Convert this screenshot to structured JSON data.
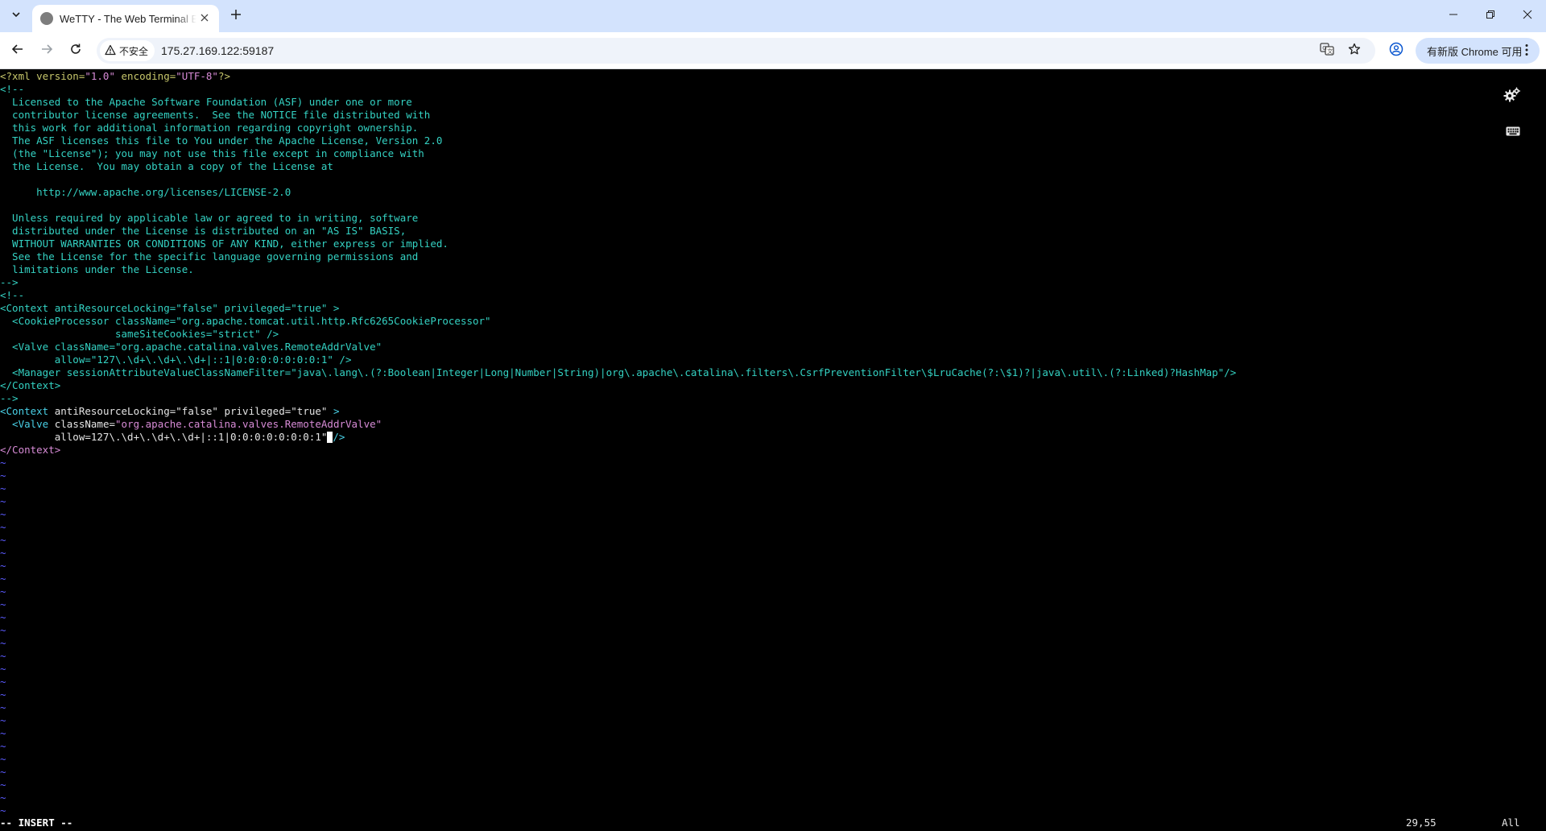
{
  "browser": {
    "tab": {
      "title": "WeTTY - The Web Terminal Emulator"
    },
    "address": {
      "security_label": "不安全",
      "url": "175.27.169.122:59187"
    },
    "update_chip": {
      "label": "有新版 Chrome 可用"
    },
    "icons": {
      "tab_search": "chevron-down-icon",
      "favicon": "globe-icon",
      "close": "close-icon",
      "new_tab": "plus-icon",
      "back": "arrow-left-icon",
      "forward": "arrow-right-icon",
      "reload": "reload-icon",
      "warning": "warning-triangle-icon",
      "translate": "translate-icon",
      "bookmark": "star-icon",
      "profile": "profile-icon",
      "menu": "kebab-menu-icon"
    }
  },
  "terminal": {
    "colors": {
      "license_comment": "#34d2c3",
      "tag": "#49d0e6",
      "attribute": "#e5e5e5",
      "value": "#d78bd6",
      "tilde": "#5b5bff"
    },
    "lines": [
      {
        "segments": [
          {
            "t": "<?xml version=",
            "c": "pi"
          },
          {
            "t": "\"1.0\"",
            "c": "val"
          },
          {
            "t": " encoding=",
            "c": "pi"
          },
          {
            "t": "\"UTF-8\"",
            "c": "val"
          },
          {
            "t": "?>",
            "c": "pi"
          }
        ]
      },
      {
        "segments": [
          {
            "t": "<!--",
            "c": "lic"
          }
        ]
      },
      {
        "segments": [
          {
            "t": "  Licensed to the Apache Software Foundation (ASF) under one or more",
            "c": "lic"
          }
        ]
      },
      {
        "segments": [
          {
            "t": "  contributor license agreements.  See the NOTICE file distributed with",
            "c": "lic"
          }
        ]
      },
      {
        "segments": [
          {
            "t": "  this work for additional information regarding copyright ownership.",
            "c": "lic"
          }
        ]
      },
      {
        "segments": [
          {
            "t": "  The ASF licenses this file to You under the Apache License, Version 2.0",
            "c": "lic"
          }
        ]
      },
      {
        "segments": [
          {
            "t": "  (the \"License\"); you may not use this file except in compliance with",
            "c": "lic"
          }
        ]
      },
      {
        "segments": [
          {
            "t": "  the License.  You may obtain a copy of the License at",
            "c": "lic"
          }
        ]
      },
      {
        "segments": [
          {
            "t": "",
            "c": "lic"
          }
        ]
      },
      {
        "segments": [
          {
            "t": "      http://www.apache.org/licenses/LICENSE-2.0",
            "c": "lic"
          }
        ]
      },
      {
        "segments": [
          {
            "t": "",
            "c": "lic"
          }
        ]
      },
      {
        "segments": [
          {
            "t": "  Unless required by applicable law or agreed to in writing, software",
            "c": "lic"
          }
        ]
      },
      {
        "segments": [
          {
            "t": "  distributed under the License is distributed on an \"AS IS\" BASIS,",
            "c": "lic"
          }
        ]
      },
      {
        "segments": [
          {
            "t": "  WITHOUT WARRANTIES OR CONDITIONS OF ANY KIND, either express or implied.",
            "c": "lic"
          }
        ]
      },
      {
        "segments": [
          {
            "t": "  See the License for the specific language governing permissions and",
            "c": "lic"
          }
        ]
      },
      {
        "segments": [
          {
            "t": "  limitations under the License.",
            "c": "lic"
          }
        ]
      },
      {
        "segments": [
          {
            "t": "-->",
            "c": "lic"
          }
        ]
      },
      {
        "segments": [
          {
            "t": "<!--",
            "c": "lic"
          }
        ]
      },
      {
        "segments": [
          {
            "t": "<Context antiResourceLocking=\"false\" privileged=\"true\" >",
            "c": "lic"
          }
        ]
      },
      {
        "segments": [
          {
            "t": "  <CookieProcessor className=\"org.apache.tomcat.util.http.Rfc6265CookieProcessor\"",
            "c": "lic"
          }
        ]
      },
      {
        "segments": [
          {
            "t": "                   sameSiteCookies=\"strict\" />",
            "c": "lic"
          }
        ]
      },
      {
        "segments": [
          {
            "t": "  <Valve className=\"org.apache.catalina.valves.RemoteAddrValve\"",
            "c": "lic"
          }
        ]
      },
      {
        "segments": [
          {
            "t": "         allow=\"127\\.\\d+\\.\\d+\\.\\d+|::1|0:0:0:0:0:0:0:1\" />",
            "c": "lic"
          }
        ]
      },
      {
        "segments": [
          {
            "t": "  <Manager sessionAttributeValueClassNameFilter=\"java\\.lang\\.(?:Boolean|Integer|Long|Number|String)|org\\.apache\\.catalina\\.filters\\.CsrfPreventionFilter\\$LruCache(?:\\$1)?|java\\.util\\.(?:Linked)?HashMap\"/>",
            "c": "lic"
          }
        ]
      },
      {
        "segments": [
          {
            "t": "</Context>",
            "c": "lic"
          }
        ]
      },
      {
        "segments": [
          {
            "t": "-->",
            "c": "lic"
          }
        ]
      },
      {
        "segments": [
          {
            "t": "<Context",
            "c": "tag"
          },
          {
            "t": " antiResourceLocking=",
            "c": "attr"
          },
          {
            "t": "\"false\"",
            "c": "valw"
          },
          {
            "t": " privileged=",
            "c": "attr"
          },
          {
            "t": "\"true\"",
            "c": "valw"
          },
          {
            "t": " >",
            "c": "tag"
          }
        ]
      },
      {
        "segments": [
          {
            "t": "  <Valve",
            "c": "tag"
          },
          {
            "t": " className=",
            "c": "attr"
          },
          {
            "t": "\"org.apache.catalina.valves.RemoteAddrValve\"",
            "c": "val"
          }
        ]
      },
      {
        "segments": [
          {
            "t": "         allow=127\\.\\d+\\.\\d+\\.\\d+|::1|0:0:0:0:0:0:0:1\"",
            "c": "valw"
          },
          {
            "t": "",
            "c": "cursor"
          },
          {
            "t": "/>",
            "c": "tag"
          }
        ]
      },
      {
        "segments": [
          {
            "t": "</Context>",
            "c": "val"
          }
        ]
      },
      {
        "segments": [
          {
            "t": "~",
            "c": "tilde"
          }
        ]
      },
      {
        "segments": [
          {
            "t": "~",
            "c": "tilde"
          }
        ]
      },
      {
        "segments": [
          {
            "t": "~",
            "c": "tilde"
          }
        ]
      },
      {
        "segments": [
          {
            "t": "~",
            "c": "tilde"
          }
        ]
      },
      {
        "segments": [
          {
            "t": "~",
            "c": "tilde"
          }
        ]
      },
      {
        "segments": [
          {
            "t": "~",
            "c": "tilde"
          }
        ]
      },
      {
        "segments": [
          {
            "t": "~",
            "c": "tilde"
          }
        ]
      },
      {
        "segments": [
          {
            "t": "~",
            "c": "tilde"
          }
        ]
      },
      {
        "segments": [
          {
            "t": "~",
            "c": "tilde"
          }
        ]
      },
      {
        "segments": [
          {
            "t": "~",
            "c": "tilde"
          }
        ]
      },
      {
        "segments": [
          {
            "t": "~",
            "c": "tilde"
          }
        ]
      },
      {
        "segments": [
          {
            "t": "~",
            "c": "tilde"
          }
        ]
      },
      {
        "segments": [
          {
            "t": "~",
            "c": "tilde"
          }
        ]
      },
      {
        "segments": [
          {
            "t": "~",
            "c": "tilde"
          }
        ]
      },
      {
        "segments": [
          {
            "t": "~",
            "c": "tilde"
          }
        ]
      },
      {
        "segments": [
          {
            "t": "~",
            "c": "tilde"
          }
        ]
      },
      {
        "segments": [
          {
            "t": "~",
            "c": "tilde"
          }
        ]
      },
      {
        "segments": [
          {
            "t": "~",
            "c": "tilde"
          }
        ]
      },
      {
        "segments": [
          {
            "t": "~",
            "c": "tilde"
          }
        ]
      },
      {
        "segments": [
          {
            "t": "~",
            "c": "tilde"
          }
        ]
      },
      {
        "segments": [
          {
            "t": "~",
            "c": "tilde"
          }
        ]
      },
      {
        "segments": [
          {
            "t": "~",
            "c": "tilde"
          }
        ]
      },
      {
        "segments": [
          {
            "t": "~",
            "c": "tilde"
          }
        ]
      },
      {
        "segments": [
          {
            "t": "~",
            "c": "tilde"
          }
        ]
      },
      {
        "segments": [
          {
            "t": "~",
            "c": "tilde"
          }
        ]
      },
      {
        "segments": [
          {
            "t": "~",
            "c": "tilde"
          }
        ]
      },
      {
        "segments": [
          {
            "t": "~",
            "c": "tilde"
          }
        ]
      },
      {
        "segments": [
          {
            "t": "~",
            "c": "tilde"
          }
        ]
      }
    ],
    "status": {
      "mode": "-- INSERT --",
      "position": "29,55",
      "scroll": "All"
    },
    "icons": {
      "settings": "settings-gears-icon",
      "keyboard": "keyboard-icon"
    }
  }
}
